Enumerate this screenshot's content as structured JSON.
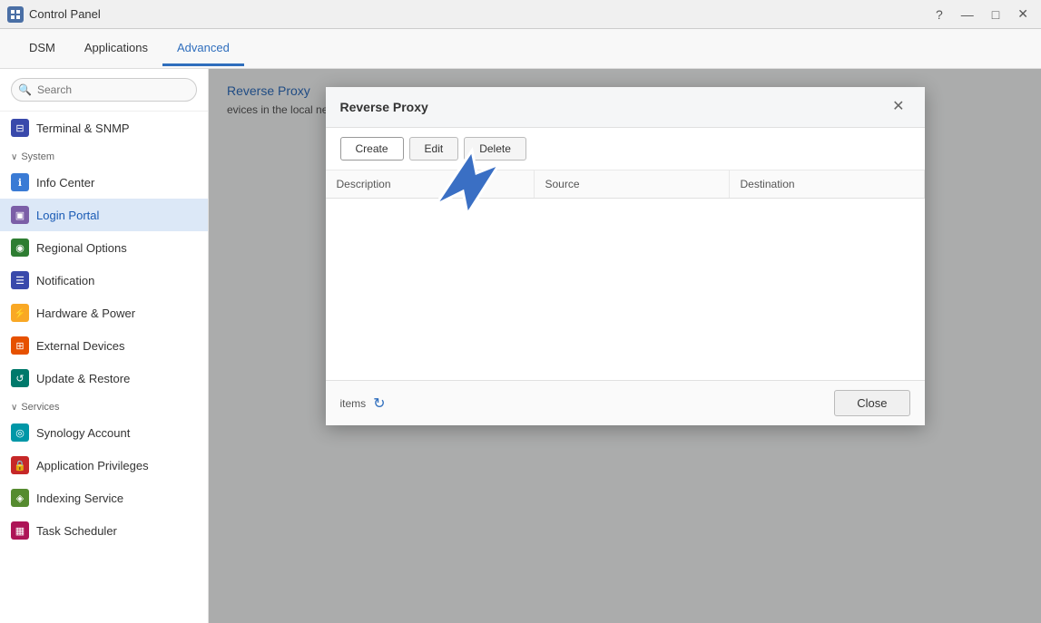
{
  "titlebar": {
    "title": "Control Panel",
    "controls": {
      "help": "?",
      "minimize": "—",
      "maximize": "□",
      "close": "✕"
    }
  },
  "top_nav": {
    "tabs": [
      {
        "id": "dsm",
        "label": "DSM",
        "active": false
      },
      {
        "id": "applications",
        "label": "Applications",
        "active": false
      },
      {
        "id": "advanced",
        "label": "Advanced",
        "active": true
      }
    ]
  },
  "sidebar": {
    "search_placeholder": "Search",
    "sections": [
      {
        "id": "system",
        "label": "System",
        "items": [
          {
            "id": "info-center",
            "label": "Info Center",
            "icon": "ℹ",
            "icon_class": "icon-blue"
          },
          {
            "id": "login-portal",
            "label": "Login Portal",
            "icon": "▣",
            "icon_class": "icon-purple",
            "active": true
          },
          {
            "id": "regional-options",
            "label": "Regional Options",
            "icon": "◉",
            "icon_class": "icon-green"
          },
          {
            "id": "notification",
            "label": "Notification",
            "icon": "☰",
            "icon_class": "icon-indigo"
          },
          {
            "id": "hardware-power",
            "label": "Hardware & Power",
            "icon": "⚡",
            "icon_class": "icon-yellow"
          },
          {
            "id": "external-devices",
            "label": "External Devices",
            "icon": "⊞",
            "icon_class": "icon-orange"
          },
          {
            "id": "update-restore",
            "label": "Update & Restore",
            "icon": "↺",
            "icon_class": "icon-teal"
          }
        ]
      },
      {
        "id": "services",
        "label": "Services",
        "items": [
          {
            "id": "synology-account",
            "label": "Synology Account",
            "icon": "◎",
            "icon_class": "icon-cyan"
          },
          {
            "id": "application-privileges",
            "label": "Application Privileges",
            "icon": "🔒",
            "icon_class": "icon-red"
          },
          {
            "id": "indexing-service",
            "label": "Indexing Service",
            "icon": "◈",
            "icon_class": "icon-lime"
          },
          {
            "id": "task-scheduler",
            "label": "Task Scheduler",
            "icon": "▦",
            "icon_class": "icon-pink"
          }
        ]
      }
    ]
  },
  "panel": {
    "breadcrumb": "Reverse Proxy",
    "description": "evices in the local network."
  },
  "modal": {
    "title": "Reverse Proxy",
    "close_label": "✕",
    "toolbar": {
      "create_label": "Create",
      "edit_label": "Edit",
      "delete_label": "Delete"
    },
    "table": {
      "columns": [
        "Description",
        "Source",
        "Destination"
      ],
      "rows": []
    },
    "footer": {
      "items_label": "items",
      "refresh_icon": "↻",
      "close_label": "Close"
    }
  },
  "terminal_snmp": {
    "label": "Terminal & SNMP"
  }
}
